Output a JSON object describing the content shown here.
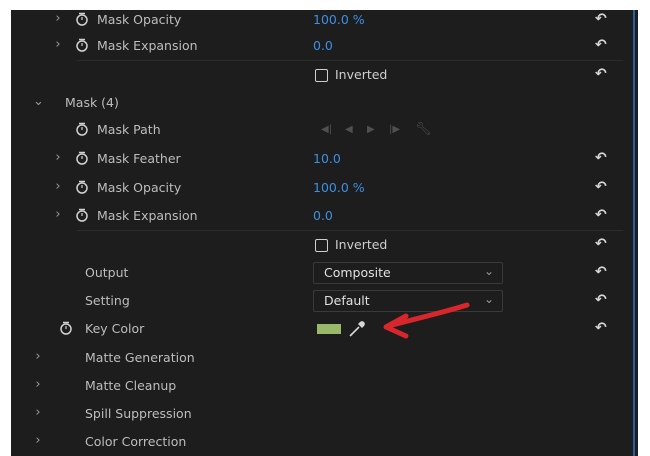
{
  "rows": {
    "mask_opacity_top": {
      "label": "Mask Opacity",
      "value": "100.0 %"
    },
    "mask_expansion_top": {
      "label": "Mask Expansion",
      "value": "0.0"
    },
    "inverted_top": {
      "label": "Inverted"
    },
    "mask4": {
      "label": "Mask (4)"
    },
    "mask_path": {
      "label": "Mask Path"
    },
    "mask_feather": {
      "label": "Mask Feather",
      "value": "10.0"
    },
    "mask_opacity": {
      "label": "Mask Opacity",
      "value": "100.0 %"
    },
    "mask_expansion": {
      "label": "Mask Expansion",
      "value": "0.0"
    },
    "inverted": {
      "label": "Inverted"
    },
    "output": {
      "label": "Output",
      "value": "Composite"
    },
    "setting": {
      "label": "Setting",
      "value": "Default"
    },
    "key_color": {
      "label": "Key Color",
      "color": "#99b86a"
    },
    "matte_generation": {
      "label": "Matte Generation"
    },
    "matte_cleanup": {
      "label": "Matte Cleanup"
    },
    "spill_suppression": {
      "label": "Spill Suppression"
    },
    "color_correction": {
      "label": "Color Correction"
    }
  },
  "icons": {
    "reset": "reset-parameter-icon",
    "stopwatch": "stopwatch-icon",
    "chevron": "chevron-icon",
    "eyedropper": "eyedropper-icon"
  },
  "colors": {
    "value_blue": "#3d8fe0",
    "annotation_red": "#d8272c",
    "accent_line": "#2d5f99"
  }
}
